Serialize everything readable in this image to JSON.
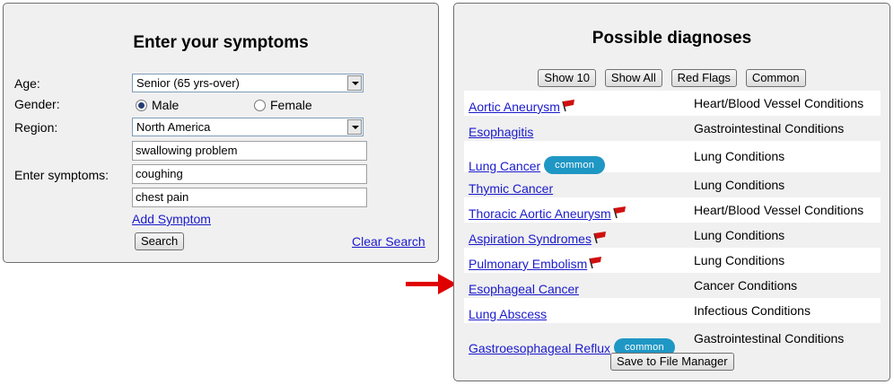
{
  "symptoms_panel": {
    "title": "Enter your symptoms",
    "age_label": "Age:",
    "age_value": "Senior (65 yrs-over)",
    "gender_label": "Gender:",
    "gender_options": [
      "Male",
      "Female"
    ],
    "gender_selected": "Male",
    "region_label": "Region:",
    "region_value": "North America",
    "symptoms_label": "Enter symptoms:",
    "symptoms": [
      "swallowing problem",
      "coughing",
      "chest pain"
    ],
    "add_symptom": "Add Symptom",
    "search_button": "Search",
    "clear_search": "Clear Search"
  },
  "diagnoses_panel": {
    "title": "Possible diagnoses",
    "filter_buttons": [
      "Show 10",
      "Show All",
      "Red Flags",
      "Common"
    ],
    "badge_text": "common",
    "rows": [
      {
        "name": "Aortic Aneurysm",
        "category": "Heart/Blood Vessel Conditions",
        "red_flag": true,
        "common": false
      },
      {
        "name": "Esophagitis",
        "category": "Gastrointestinal Conditions",
        "red_flag": false,
        "common": false
      },
      {
        "name": "Lung Cancer",
        "category": "Lung Conditions",
        "red_flag": false,
        "common": true
      },
      {
        "name": "Thymic Cancer",
        "category": "Lung Conditions",
        "red_flag": false,
        "common": false
      },
      {
        "name": "Thoracic Aortic Aneurysm",
        "category": "Heart/Blood Vessel Conditions",
        "red_flag": true,
        "common": false
      },
      {
        "name": "Aspiration Syndromes",
        "category": "Lung Conditions",
        "red_flag": true,
        "common": false
      },
      {
        "name": "Pulmonary Embolism",
        "category": "Lung Conditions",
        "red_flag": true,
        "common": false
      },
      {
        "name": "Esophageal Cancer",
        "category": "Cancer Conditions",
        "red_flag": false,
        "common": false
      },
      {
        "name": "Lung Abscess",
        "category": "Infectious Conditions",
        "red_flag": false,
        "common": false
      },
      {
        "name": "Gastroesophageal Reflux",
        "category": "Gastrointestinal Conditions",
        "red_flag": false,
        "common": true
      }
    ],
    "save_button": "Save to File Manager"
  },
  "colors": {
    "link": "#1a1acc",
    "badge": "#1f97c4",
    "flag": "#d01010",
    "pointer_arrow": "#e00000"
  },
  "icons": {
    "red_flag": "red-flag-icon",
    "pointer": "red-arrow-icon"
  }
}
